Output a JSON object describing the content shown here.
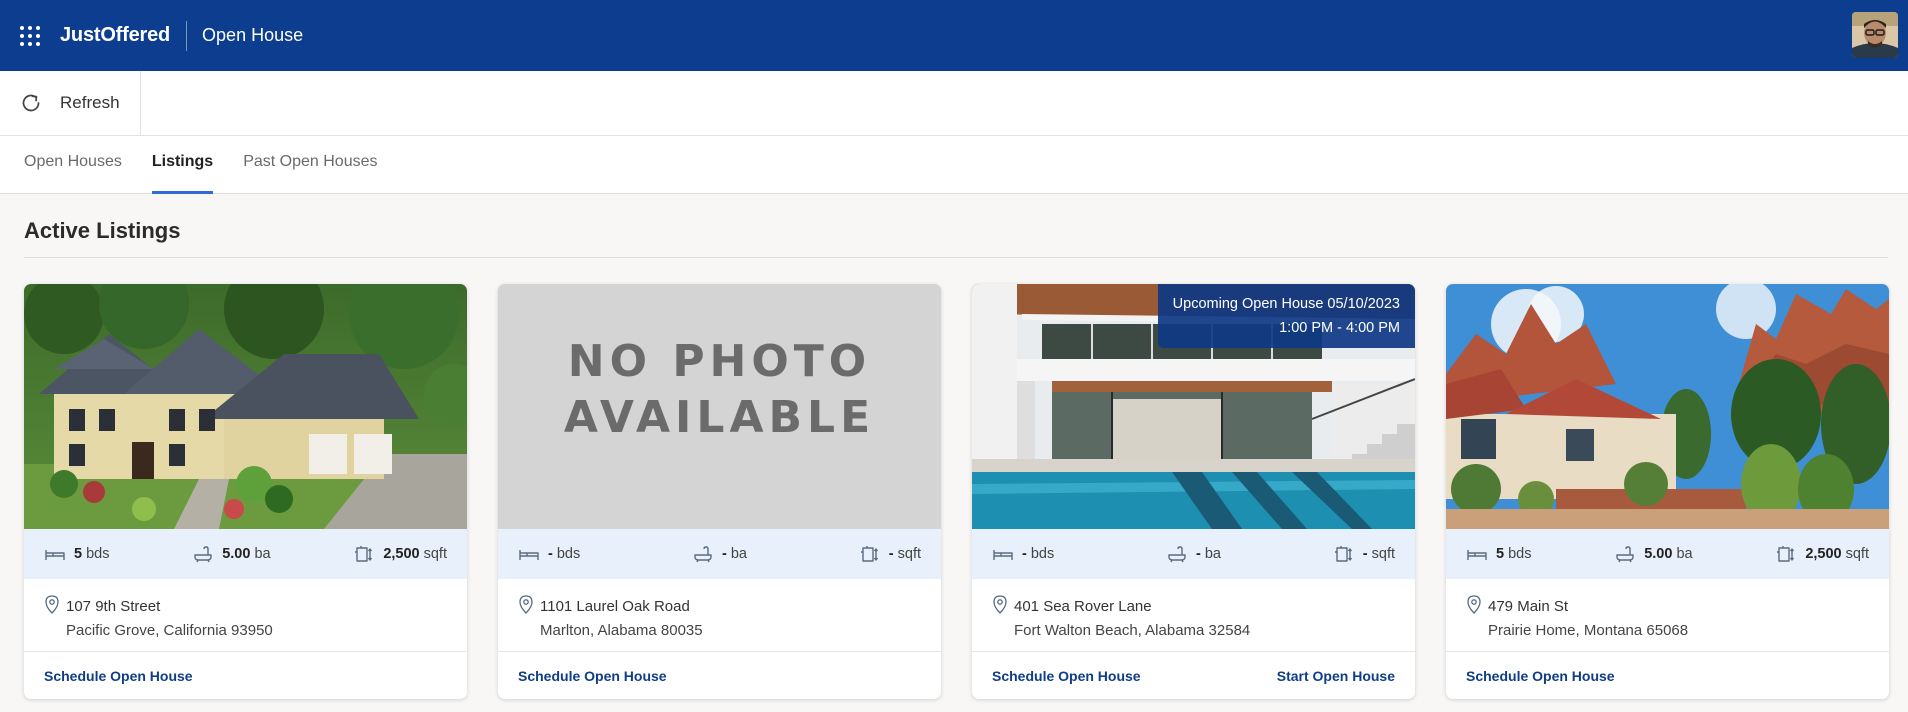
{
  "header": {
    "brand": "JustOffered",
    "app_name": "Open House",
    "apps_icon": "apps-grid-icon",
    "avatar": "user-avatar"
  },
  "toolbar": {
    "refresh_label": "Refresh",
    "refresh_icon": "refresh-icon"
  },
  "tabs": [
    {
      "label": "Open Houses",
      "active": false
    },
    {
      "label": "Listings",
      "active": true
    },
    {
      "label": "Past Open Houses",
      "active": false
    }
  ],
  "section": {
    "title": "Active Listings"
  },
  "listings": [
    {
      "photo": "house-photo",
      "badge_line1": "",
      "badge_line2": "",
      "beds_value": "5",
      "beds_unit": "bds",
      "baths_value": "5.00",
      "baths_unit": "ba",
      "sqft_value": "2,500",
      "sqft_unit": "sqft",
      "address_line1": "107 9th Street",
      "address_line2": "Pacific Grove, California 93950",
      "primary_action": "Schedule Open House",
      "secondary_action": ""
    },
    {
      "photo": "no-photo-placeholder",
      "placeholder_line1": "NO PHOTO",
      "placeholder_line2": "AVAILABLE",
      "badge_line1": "",
      "badge_line2": "",
      "beds_value": "-",
      "beds_unit": "bds",
      "baths_value": "-",
      "baths_unit": "ba",
      "sqft_value": "-",
      "sqft_unit": "sqft",
      "address_line1": "1101 Laurel Oak Road",
      "address_line2": "Marlton, Alabama 80035",
      "primary_action": "Schedule Open House",
      "secondary_action": ""
    },
    {
      "photo": "modern-house-pool-photo",
      "badge_line1": "Upcoming Open House 05/10/2023",
      "badge_line2": "1:00 PM - 4:00 PM",
      "beds_value": "-",
      "beds_unit": "bds",
      "baths_value": "-",
      "baths_unit": "ba",
      "sqft_value": "-",
      "sqft_unit": "sqft",
      "address_line1": "401 Sea Rover Lane",
      "address_line2": "Fort Walton Beach, Alabama 32584",
      "primary_action": "Schedule Open House",
      "secondary_action": "Start Open House"
    },
    {
      "photo": "desert-house-photo",
      "badge_line1": "",
      "badge_line2": "",
      "beds_value": "5",
      "beds_unit": "bds",
      "baths_value": "5.00",
      "baths_unit": "ba",
      "sqft_value": "2,500",
      "sqft_unit": "sqft",
      "address_line1": "479 Main St",
      "address_line2": "Prairie Home, Montana 65068",
      "primary_action": "Schedule Open House",
      "secondary_action": ""
    }
  ],
  "colors": {
    "header_bg": "#0d3d8e",
    "tab_indicator": "#2f6bd6",
    "stats_bg": "#e8f0fb",
    "action_link": "#0f3d87"
  }
}
